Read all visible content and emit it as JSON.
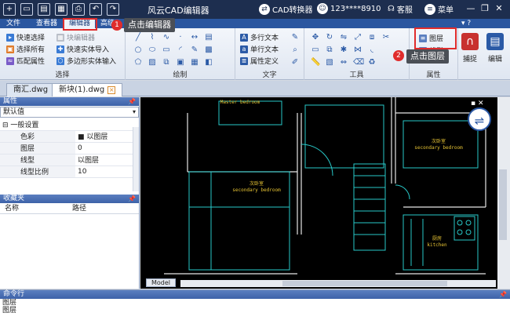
{
  "titlebar": {
    "quick_access": [
      "+",
      "▭",
      "▤",
      "▦",
      "⎙",
      "↶",
      "↷"
    ],
    "app_title": "风云CAD编辑器",
    "converter_label": "CAD转换器",
    "user_label": "123****8910",
    "service_label": "客服",
    "menu_label": "菜单",
    "win_buttons": [
      "—",
      "❐",
      "✕"
    ]
  },
  "tabs": [
    {
      "label": "文件"
    },
    {
      "label": "查看器"
    },
    {
      "label": "编辑器"
    },
    {
      "label": "高级"
    }
  ],
  "ribbon_right": "▾ ?",
  "ribbon": {
    "select_group": {
      "label": "选择",
      "items": [
        {
          "label": "快速选择"
        },
        {
          "label": "块编辑器"
        },
        {
          "label": "选择所有"
        },
        {
          "label": "快速实体导入"
        },
        {
          "label": "匹配属性"
        },
        {
          "label": "多边形实体输入"
        }
      ]
    },
    "draw_group": {
      "label": "绘制"
    },
    "text_group": {
      "label": "文字",
      "items": [
        {
          "label": "多行文本"
        },
        {
          "label": "单行文本"
        },
        {
          "label": "属性定义"
        }
      ]
    },
    "tools_group": {
      "label": "工具"
    },
    "props_group": {
      "label": "属性",
      "layer_label": "图层",
      "linetype_label": "线型"
    },
    "snap_label": "捕捉",
    "edit_label": "编辑"
  },
  "doc_tabs": [
    {
      "label": "南汇.dwg"
    },
    {
      "label": "新块(1).dwg"
    }
  ],
  "properties_panel": {
    "title": "属性",
    "dropdown_value": "默认值",
    "section": "一般设置",
    "rows": [
      {
        "key": "色彩",
        "value": "以图层"
      },
      {
        "key": "图层",
        "value": "0"
      },
      {
        "key": "线型",
        "value": "以图层"
      },
      {
        "key": "线型比例",
        "value": "10"
      }
    ]
  },
  "favorites_panel": {
    "title": "收藏夹",
    "col_name": "名称",
    "col_path": "路径"
  },
  "drawing": {
    "rooms": [
      {
        "cn": "",
        "en": "Master bedroom"
      },
      {
        "cn": "次卧室",
        "en": "secondary bedroom"
      },
      {
        "cn": "次卧室",
        "en": "secondary bedroom"
      },
      {
        "cn": "厨房",
        "en": "kitchen"
      }
    ],
    "model_tab": "Model"
  },
  "command_panel": {
    "title": "命令行",
    "lines": [
      "图层",
      "图层"
    ]
  },
  "annotations": {
    "step1_badge": "1",
    "step1_tip": "点击编辑器",
    "step2_badge": "2",
    "step2_tip": "点击图层"
  }
}
